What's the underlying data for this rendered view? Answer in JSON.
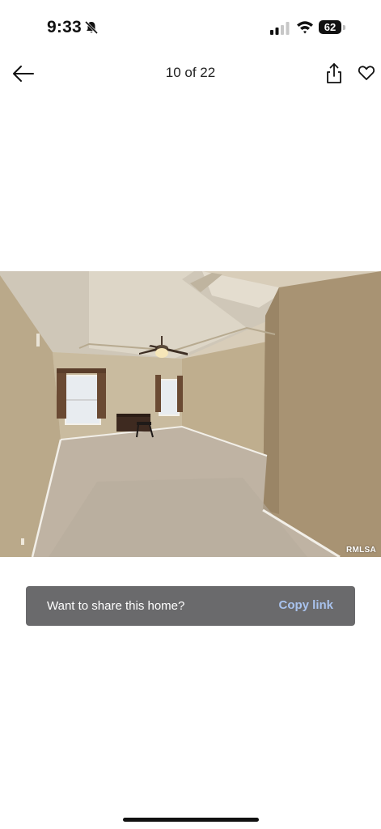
{
  "status_bar": {
    "time": "9:33",
    "battery_level": "62",
    "icons": [
      "bell-slash-icon",
      "cellular-signal-icon",
      "wifi-icon",
      "battery-icon"
    ]
  },
  "nav": {
    "counter": "10 of 22",
    "icons": [
      "arrow-left-icon",
      "share-icon",
      "heart-icon"
    ]
  },
  "photo": {
    "watermark": "RMLSA"
  },
  "share_toast": {
    "message": "Want to share this home?",
    "action_label": "Copy link",
    "action_color": "#a9c3ee",
    "background_color": "#6a6a6c"
  }
}
